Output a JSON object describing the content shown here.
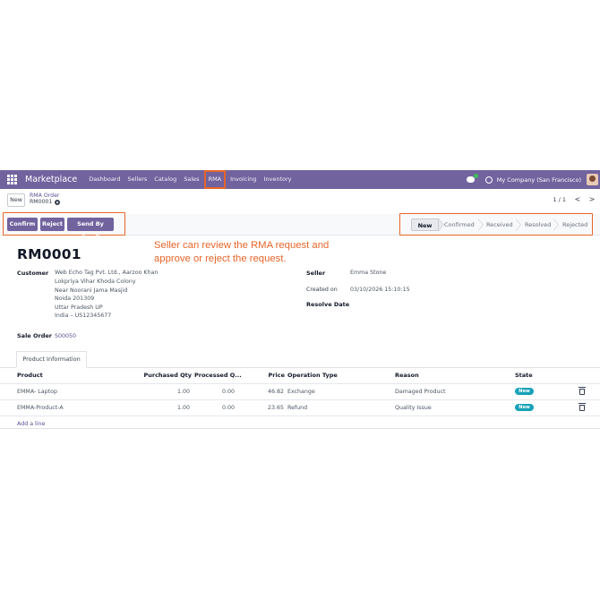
{
  "navbar": {
    "brand": "Marketplace",
    "menu": [
      "Dashboard",
      "Sellers",
      "Catalog",
      "Sales",
      "RMA",
      "Invoicing",
      "Inventory"
    ],
    "active_menu": "RMA",
    "company": "My Company (San Francisco)",
    "icons": [
      "apps-grid-icon",
      "chat-icon",
      "clock-icon",
      "user-avatar"
    ]
  },
  "control_panel": {
    "new_label": "New",
    "breadcrumb_parent": "RMA Order",
    "breadcrumb_current": "RM0001",
    "pager": "1 / 1",
    "prev": "<",
    "next": ">"
  },
  "actions": {
    "confirm": "Confirm",
    "reject": "Reject",
    "send_email": "Send By Email"
  },
  "stages": {
    "items": [
      "New",
      "Confirmed",
      "Received",
      "Resolved",
      "Rejected"
    ],
    "current": "New"
  },
  "annotation": {
    "line1": "Seller can review the RMA request and",
    "line2": "approve or reject the request."
  },
  "form": {
    "title": "RM0001",
    "customer_label": "Customer",
    "customer_name": "Web Echo Tag Pvt. Ltd., Aarzoo Khan",
    "customer_address": [
      "Lokpriya Vihar Khoda Colony",
      "Near Noorani Jama Masjid",
      "Noida 201309",
      "Uttar Pradesh UP",
      "India – US12345677"
    ],
    "sale_order_label": "Sale Order",
    "sale_order": "S00050",
    "seller_label": "Seller",
    "seller": "Emma Stone",
    "created_on_label": "Created on",
    "created_on": "03/10/2026 15:10:15",
    "resolve_date_label": "Resolve Date",
    "resolve_date": ""
  },
  "tab": {
    "label": "Product Information"
  },
  "table": {
    "columns": [
      "Product",
      "Purchased Qty",
      "Processed Q...",
      "Price",
      "Operation Type",
      "Reason",
      "State"
    ],
    "rows": [
      {
        "product": "EMMA- Laptop",
        "purchased_qty": "1.00",
        "processed_qty": "0.00",
        "price": "46.82",
        "operation": "Exchange",
        "reason": "Damaged Product",
        "state": "New"
      },
      {
        "product": "EMMA-Product-A",
        "purchased_qty": "1.00",
        "processed_qty": "0.00",
        "price": "23.65",
        "operation": "Refund",
        "reason": "Quality Issue",
        "state": "New"
      }
    ],
    "add_line": "Add a line"
  },
  "colors": {
    "navbar": "#71639e",
    "highlight": "#e8652a",
    "badge": "#17a2b8",
    "button": "#71639e"
  }
}
